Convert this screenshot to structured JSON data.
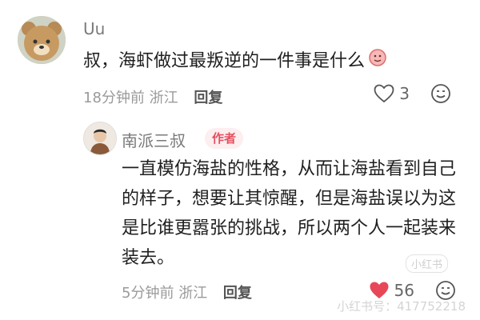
{
  "comments": [
    {
      "username": "Uu",
      "text": "叔，海虾做过最叛逆的一件事是什么",
      "time": "18分钟前",
      "location": "浙江",
      "reply_label": "回复",
      "like_count": "3",
      "liked": false
    },
    {
      "username": "南派三叔",
      "badge": "作者",
      "text": "一直模仿海盐的性格，从而让海盐看到自己的样子，想要让其惊醒，但是海盐误以为这是比谁更嚣张的挑战，所以两个人一起装来装去。",
      "time": "5分钟前",
      "location": "浙江",
      "reply_label": "回复",
      "like_count": "56",
      "liked": true
    }
  ],
  "colors": {
    "badge_text": "#e4505f",
    "badge_bg": "#fdeef0",
    "like_active": "#e8475a"
  },
  "watermark": {
    "tag": "小红书",
    "text": "小红书号：417752218"
  }
}
